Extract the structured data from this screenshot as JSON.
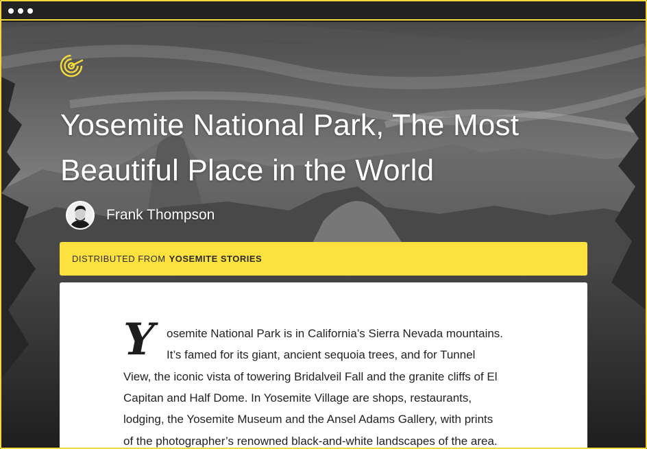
{
  "window": {
    "titlebar_dots": 3,
    "accent_color": "#f5d83a"
  },
  "logo": {
    "icon": "target-spiral-icon",
    "color": "#f5d83a"
  },
  "article": {
    "title_line_1": "Yosemite National Park, The Most",
    "title_line_2": "Beautiful Place in the World",
    "author": {
      "name": "Frank Thompson",
      "avatar_icon": "person-avatar"
    },
    "distribution": {
      "prefix": "DISTRIBUTED FROM",
      "source": "YOSEMITE STORIES",
      "background_color": "#fde23f"
    },
    "body": {
      "drop_cap": "Y",
      "lines": [
        "osemite National Park is in California’s Sierra  Nevada mountains.",
        "It’s famed for its giant, ancient sequoia trees, and for Tunnel",
        "View, the iconic vista of towering Bridalveil Fall and the granite cliffs of El",
        "Capitan and Half Dome. In Yosemite Village are shops, restaurants,",
        "lodging, the Yosemite Museum and the Ansel Adams Gallery, with prints",
        "of the photographer’s renowned black-and-white landscapes of the area."
      ]
    }
  }
}
